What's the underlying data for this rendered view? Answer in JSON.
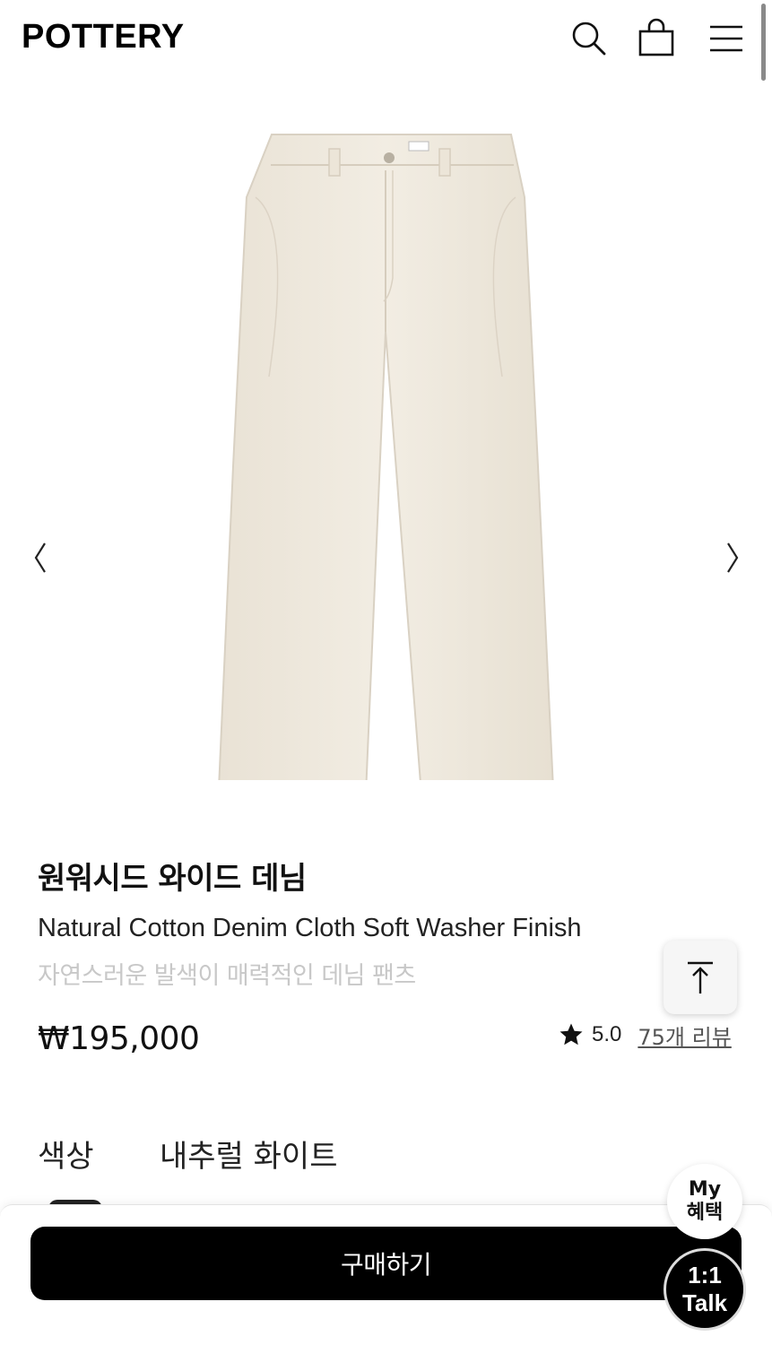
{
  "header": {
    "logo": "POTTERY",
    "icons": [
      "search-icon",
      "shopping-bag-icon",
      "menu-icon"
    ]
  },
  "gallery": {
    "prev_icon": "chevron-left-icon",
    "next_icon": "chevron-right-icon",
    "image_colors": {
      "fabric": "#efe9dd",
      "shadow": "#d9d1c3"
    }
  },
  "product": {
    "title_ko": "원워시드 와이드 데님",
    "title_en": "Natural Cotton Denim Cloth Soft Washer Finish",
    "description": "자연스러운 발색이 매력적인 데님 팬츠",
    "price": "₩195,000",
    "rating": "5.0",
    "reviews_link": "75개 리뷰"
  },
  "options": {
    "color_label": "색상",
    "color_value": "내추럴 화이트"
  },
  "actions": {
    "buy_label": "구매하기"
  },
  "floating": {
    "scroll_top_icon": "arrow-up-to-top-icon",
    "my_line1": "My",
    "my_line2": "혜택",
    "talk_line1": "1:1",
    "talk_line2": "Talk"
  }
}
